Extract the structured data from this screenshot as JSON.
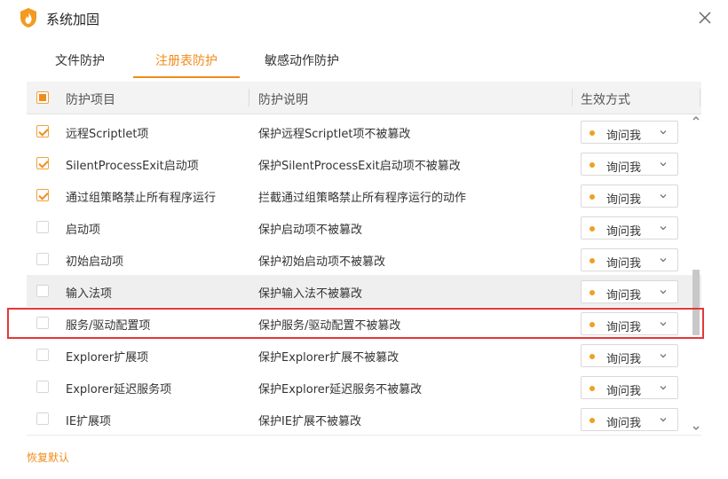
{
  "window": {
    "title": "系统加固",
    "logo_icon": "flame-shield-icon",
    "close_icon": "close-icon"
  },
  "tabs": [
    {
      "label": "文件防护",
      "active": false
    },
    {
      "label": "注册表防护",
      "active": true
    },
    {
      "label": "敏感动作防护",
      "active": false
    }
  ],
  "table": {
    "headers": {
      "item": "防护项目",
      "desc": "防护说明",
      "mode": "生效方式"
    },
    "select_all_state": "partial",
    "rows": [
      {
        "name": "远程Scriptlet项",
        "desc": "保护远程Scriptlet项不被篡改",
        "mode": "询问我",
        "checked": true
      },
      {
        "name": "SilentProcessExit启动项",
        "desc": "保护SilentProcessExit启动项不被篡改",
        "mode": "询问我",
        "checked": true
      },
      {
        "name": "通过组策略禁止所有程序运行",
        "desc": "拦截通过组策略禁止所有程序运行的动作",
        "mode": "询问我",
        "checked": true
      },
      {
        "name": "启动项",
        "desc": "保护启动项不被篡改",
        "mode": "询问我",
        "checked": false
      },
      {
        "name": "初始启动项",
        "desc": "保护初始启动项不被篡改",
        "mode": "询问我",
        "checked": false
      },
      {
        "name": "输入法项",
        "desc": "保护输入法不被篡改",
        "mode": "询问我",
        "checked": false
      },
      {
        "name": "服务/驱动配置项",
        "desc": "保护服务/驱动配置不被篡改",
        "mode": "询问我",
        "checked": false
      },
      {
        "name": "Explorer扩展项",
        "desc": "保护Explorer扩展不被篡改",
        "mode": "询问我",
        "checked": false
      },
      {
        "name": "Explorer延迟服务项",
        "desc": "保护Explorer延迟服务不被篡改",
        "mode": "询问我",
        "checked": false
      },
      {
        "name": "IE扩展项",
        "desc": "保护IE扩展不被篡改",
        "mode": "询问我",
        "checked": false
      }
    ]
  },
  "footer": {
    "restore_label": "恢复默认"
  },
  "colors": {
    "accent": "#f08c1a",
    "highlight_border": "#e2393a",
    "mode_dot": "#f0a020"
  }
}
